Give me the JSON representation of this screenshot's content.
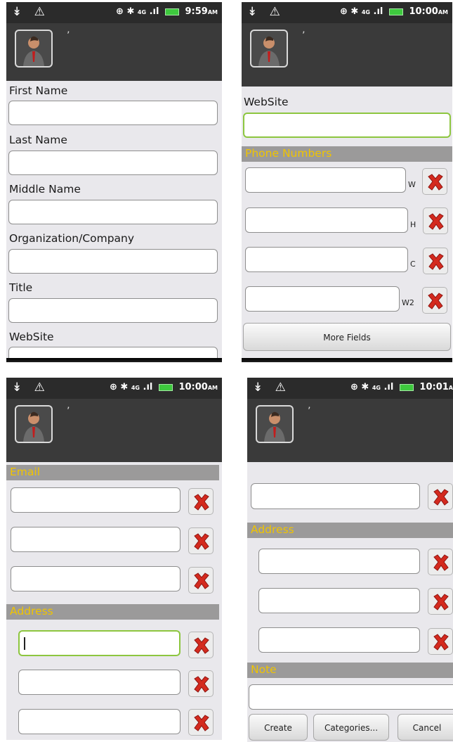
{
  "status_bars": [
    {
      "time": "9:59",
      "ampm": "AM"
    },
    {
      "time": "10:00",
      "ampm": "AM"
    },
    {
      "time": "10:00",
      "ampm": "AM"
    },
    {
      "time": "10:01",
      "ampm": "A"
    }
  ],
  "status_icons": {
    "left": "↡ ⚠",
    "network": "4G",
    "signal": ".ıl"
  },
  "header": {
    "name_text": "’"
  },
  "panel1": {
    "labels": [
      "First Name",
      "Last Name",
      "Middle Name",
      "Organization/Company",
      "Title",
      "WebSite"
    ]
  },
  "panel2": {
    "website_label": "WebSite",
    "phone_section": "Phone Numbers",
    "phone_types": [
      "W",
      "H",
      "C",
      "W2"
    ],
    "more_fields_label": "More Fields"
  },
  "panel3": {
    "email_section": "Email",
    "address_section": "Address"
  },
  "panel4": {
    "address_section": "Address",
    "note_section": "Note",
    "buttons": {
      "create": "Create",
      "categories": "Categories...",
      "cancel": "Cancel"
    }
  },
  "colors": {
    "section_text": "#f0c400",
    "focus_border": "#8dc63f",
    "delete_icon": "#d42a1e"
  }
}
